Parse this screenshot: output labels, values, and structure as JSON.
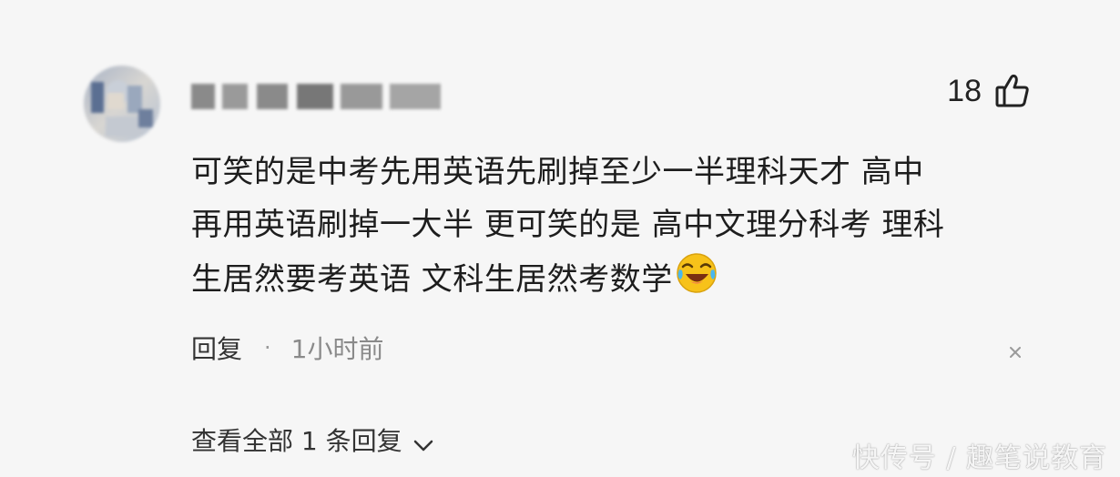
{
  "comment": {
    "author_name": "凡写昌诚程华",
    "like_count": "18",
    "text_lines": [
      "可笑的是中考先用英语先刷掉至少一半理科天才 高中",
      "再用英语刷掉一大半 更可笑的是 高中文理分科考 理科",
      "生居然要考英语 文科生居然考数学"
    ],
    "emoji": "laugh-cry-emoji",
    "reply_label": "回复",
    "separator": "·",
    "time_ago": "1小时前",
    "view_all_replies": "查看全部 1 条回复"
  },
  "watermark": "快传号 / 趣笔说教育",
  "icons": {
    "like": "thumbs-up-icon",
    "close": "close-icon",
    "expand": "chevron-down-icon"
  },
  "colors": {
    "background": "#f6f6f6",
    "text": "#1d1d1d",
    "muted": "#8a8a8a",
    "emoji_yellow": "#f7c21a"
  }
}
